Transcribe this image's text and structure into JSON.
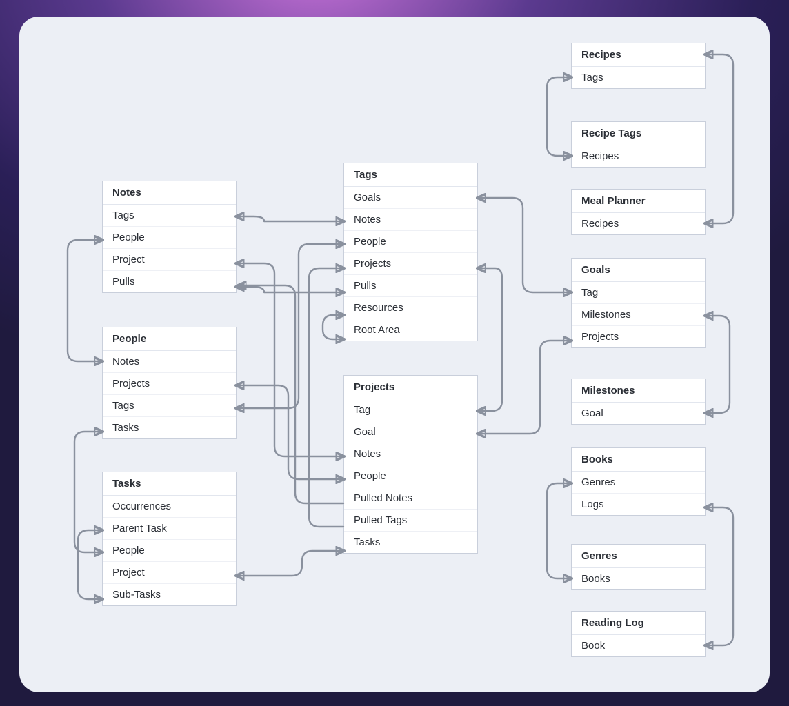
{
  "entities": {
    "notes": {
      "title": "Notes",
      "rows": [
        "Tags",
        "People",
        "Project",
        "Pulls"
      ]
    },
    "people": {
      "title": "People",
      "rows": [
        "Notes",
        "Projects",
        "Tags",
        "Tasks"
      ]
    },
    "tasks": {
      "title": "Tasks",
      "rows": [
        "Occurrences",
        "Parent Task",
        "People",
        "Project",
        "Sub-Tasks"
      ]
    },
    "tags": {
      "title": "Tags",
      "rows": [
        "Goals",
        "Notes",
        "People",
        "Projects",
        "Pulls",
        "Resources",
        "Root Area"
      ]
    },
    "projects": {
      "title": "Projects",
      "rows": [
        "Tag",
        "Goal",
        "Notes",
        "People",
        "Pulled Notes",
        "Pulled Tags",
        "Tasks"
      ]
    },
    "recipes": {
      "title": "Recipes",
      "rows": [
        "Tags"
      ]
    },
    "recipetags": {
      "title": "Recipe Tags",
      "rows": [
        "Recipes"
      ]
    },
    "mealplanner": {
      "title": "Meal Planner",
      "rows": [
        "Recipes"
      ]
    },
    "goals": {
      "title": "Goals",
      "rows": [
        "Tag",
        "Milestones",
        "Projects"
      ]
    },
    "milestones": {
      "title": "Milestones",
      "rows": [
        "Goal"
      ]
    },
    "books": {
      "title": "Books",
      "rows": [
        "Genres",
        "Logs"
      ]
    },
    "genres": {
      "title": "Genres",
      "rows": [
        "Books"
      ]
    },
    "readinglog": {
      "title": "Reading Log",
      "rows": [
        "Book"
      ]
    }
  }
}
